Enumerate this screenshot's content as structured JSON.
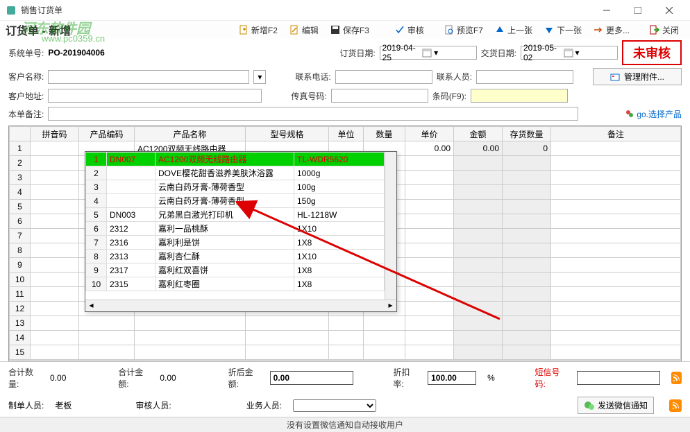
{
  "window": {
    "title": "销售订货单"
  },
  "page": {
    "title": "订货单 - 新增",
    "watermark1": "河东软件园",
    "watermark2": "www.pc0359.cn"
  },
  "toolbar": {
    "new": "新增F2",
    "edit": "编辑",
    "save": "保存F3",
    "audit": "审核",
    "preview": "预览F7",
    "prev": "上一张",
    "next": "下一张",
    "more": "更多...",
    "close": "关闭"
  },
  "form": {
    "sysno_label": "系统单号:",
    "sysno": "PO-201904006",
    "orderdate_label": "订货日期:",
    "orderdate": "2019-04-25",
    "delivdate_label": "交货日期:",
    "delivdate": "2019-05-02",
    "stamp": "未审核",
    "custname_label": "客户名称:",
    "phone_label": "联系电话:",
    "contact_label": "联系人员:",
    "custaddr_label": "客户地址:",
    "fax_label": "传真号码:",
    "barcode_label": "条码(F9):",
    "remark_label": "本单备注:",
    "attach_btn": "管理附件...",
    "select_prod": "go.选择产品"
  },
  "grid": {
    "headers": [
      "拼音码",
      "产品编码",
      "产品名称",
      "型号规格",
      "单位",
      "数量",
      "单价",
      "金额",
      "存货数量",
      "备注"
    ],
    "row1": {
      "name": "AC1200双频无线路由器",
      "price": "0.00",
      "amount": "0.00",
      "stock": "0"
    }
  },
  "popup": {
    "rows": [
      {
        "n": "1",
        "code": "DN007",
        "name": "AC1200双频无线路由器",
        "spec": "TL-WDR5620"
      },
      {
        "n": "2",
        "code": "",
        "name": "DOVE樱花甜香滋养美肤沐浴露",
        "spec": "1000g"
      },
      {
        "n": "3",
        "code": "",
        "name": "云南白药牙膏-薄荷香型",
        "spec": "100g"
      },
      {
        "n": "4",
        "code": "",
        "name": "云南白药牙膏-薄荷香型",
        "spec": "150g"
      },
      {
        "n": "5",
        "code": "DN003",
        "name": "兄弟黑白激光打印机",
        "spec": "HL-1218W"
      },
      {
        "n": "6",
        "code": "2312",
        "name": "嘉利一品桃酥",
        "spec": "1X10"
      },
      {
        "n": "7",
        "code": "2316",
        "name": "嘉利利是饼",
        "spec": "1X8"
      },
      {
        "n": "8",
        "code": "2313",
        "name": "嘉利杏仁酥",
        "spec": "1X10"
      },
      {
        "n": "9",
        "code": "2317",
        "name": "嘉利红双喜饼",
        "spec": "1X8"
      },
      {
        "n": "10",
        "code": "2315",
        "name": "嘉利红枣圈",
        "spec": "1X8"
      }
    ]
  },
  "footer": {
    "totalqty_label": "合计数量:",
    "totalqty": "0.00",
    "totalamt_label": "合计金额:",
    "totalamt": "0.00",
    "discamt_label": "折后金额:",
    "discamt": "0.00",
    "discrate_label": "折扣率:",
    "discrate": "100.00",
    "pct": "%",
    "sms_label": "短信号码:"
  },
  "footer2": {
    "maker_label": "制单人员:",
    "maker": "老板",
    "auditor_label": "审核人员:",
    "biz_label": "业务人员:",
    "wx_btn": "发送微信通知"
  },
  "status": "没有设置微信通知自动接收用户"
}
